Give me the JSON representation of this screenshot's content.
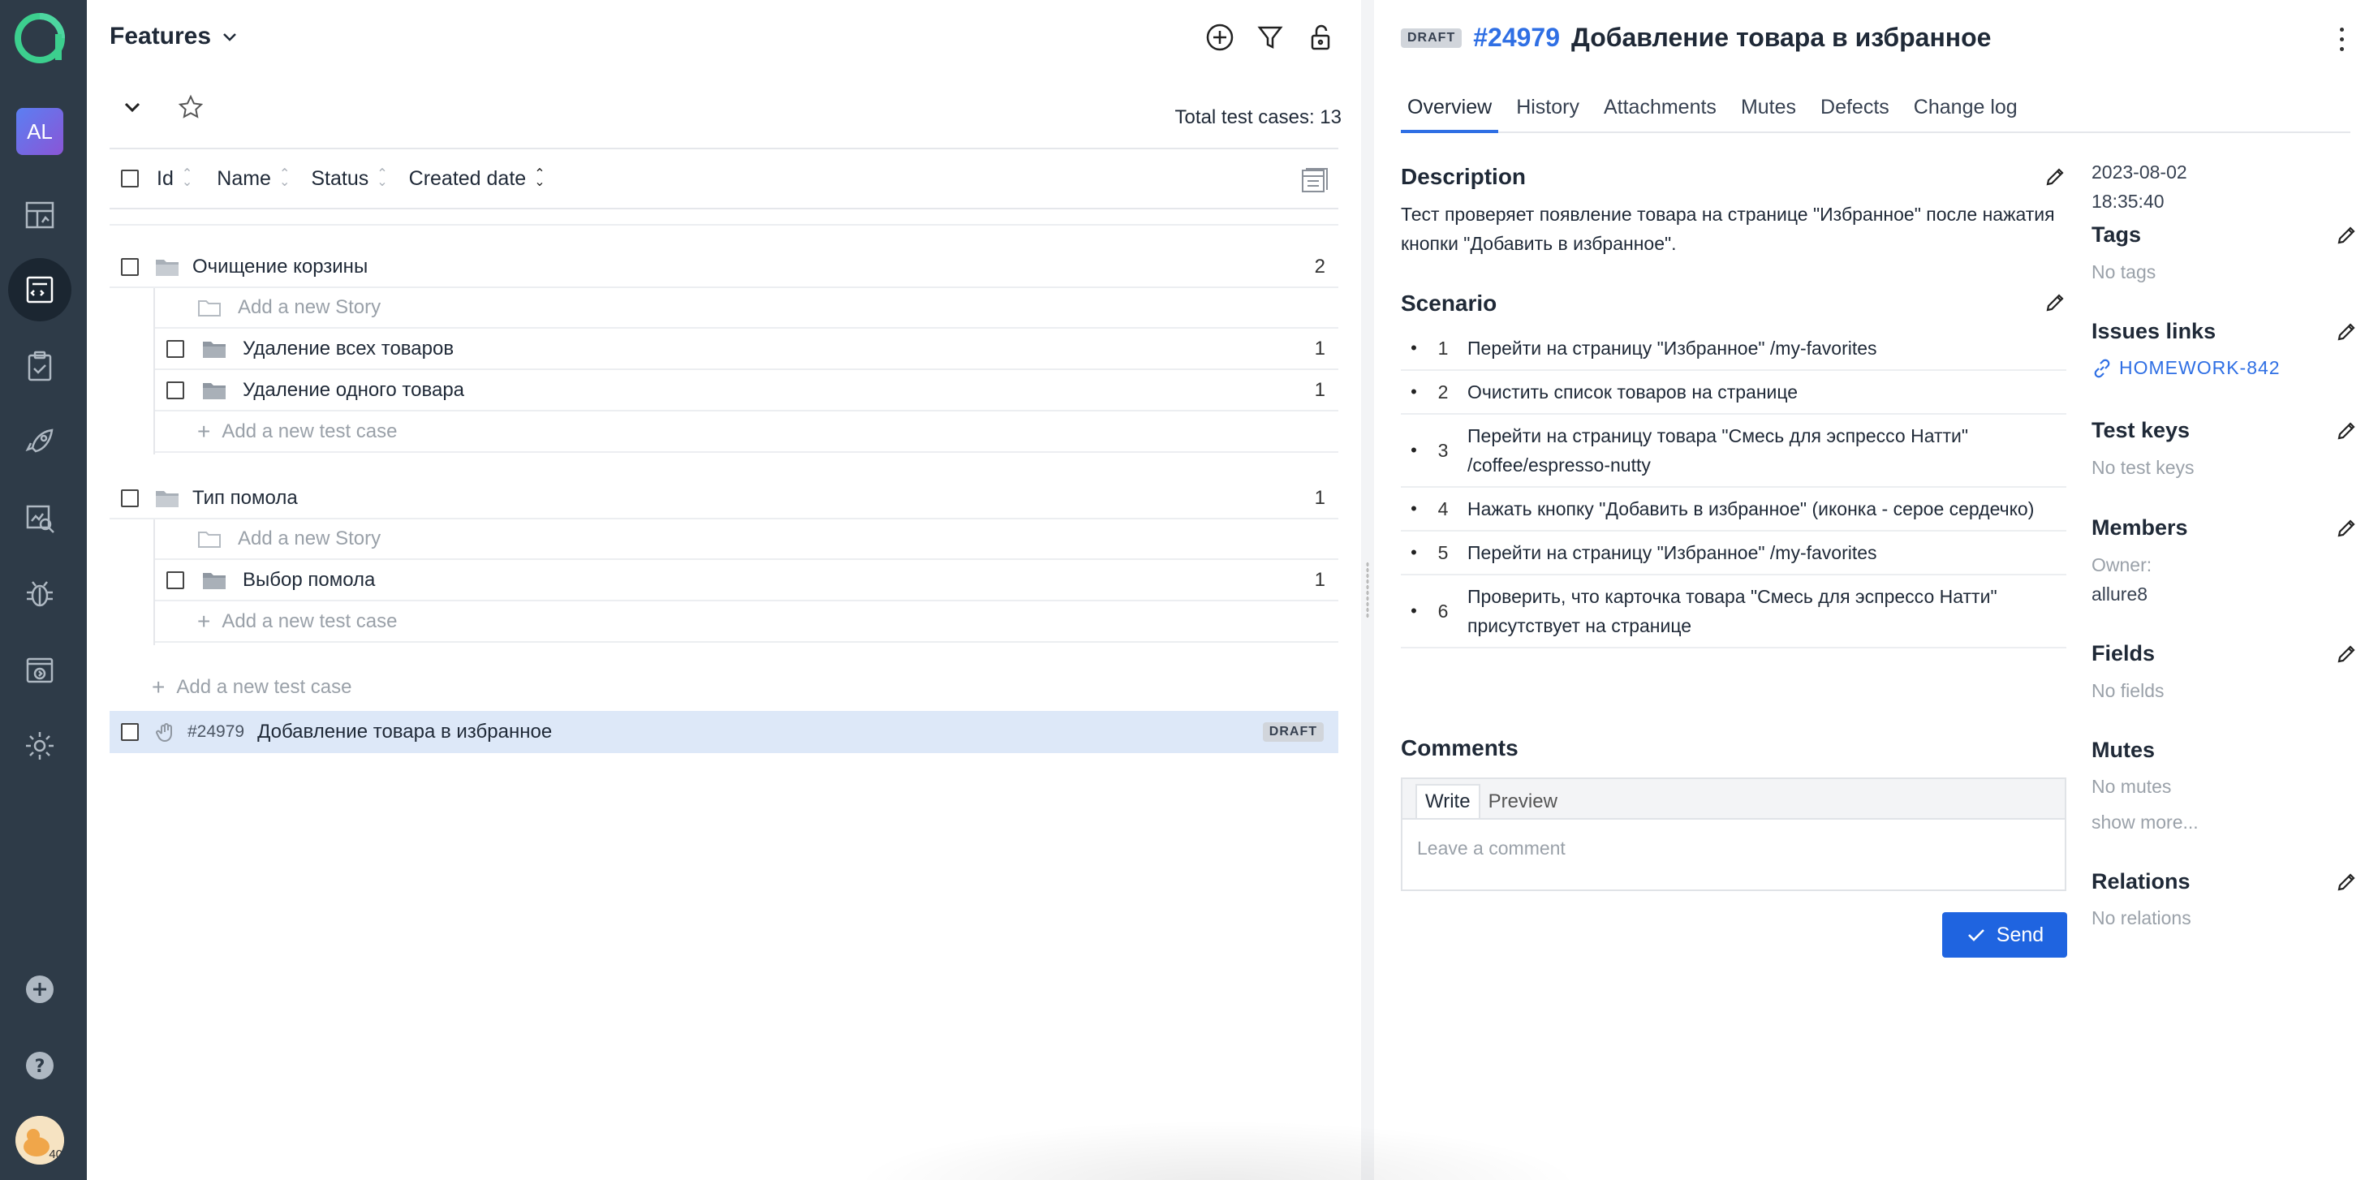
{
  "rail": {
    "avatar_initials": "AL",
    "user_badge": "40",
    "icons": [
      "dashboard-icon",
      "test-cases-icon",
      "test-plans-icon",
      "launches-icon",
      "analytics-icon",
      "defects-icon",
      "jobs-icon",
      "settings-icon",
      "add-project-icon",
      "help-icon"
    ]
  },
  "left": {
    "title": "Features",
    "total_label": "Total test cases: 13",
    "columns": [
      "Id",
      "Name",
      "Status",
      "Created date"
    ],
    "groups": [
      {
        "name": "Очищение корзины",
        "count": "2",
        "add_story": "Add a new Story",
        "children": [
          {
            "name": "Удаление всех товаров",
            "count": "1"
          },
          {
            "name": "Удаление одного товара",
            "count": "1"
          }
        ],
        "add_test_case": "Add a new test case"
      },
      {
        "name": "Тип помола",
        "count": "1",
        "add_story": "Add a new Story",
        "children": [
          {
            "name": "Выбор помола",
            "count": "1"
          }
        ],
        "add_test_case": "Add a new test case"
      }
    ],
    "add_test_case": "Add a new test case",
    "selected": {
      "id": "#24979",
      "name": "Добавление товара в избранное",
      "badge": "DRAFT"
    }
  },
  "right": {
    "badge": "DRAFT",
    "number": "#24979",
    "title": "Добавление товара в избранное",
    "tabs": [
      "Overview",
      "History",
      "Attachments",
      "Mutes",
      "Defects",
      "Change log"
    ],
    "description_title": "Description",
    "description": "Тест проверяет появление товара на странице \"Избранное\" после нажатия кнопки \"Добавить в избранное\".",
    "scenario_title": "Scenario",
    "steps": [
      {
        "n": "1",
        "text": "Перейти на страницу \"Избранное\"  /my-favorites"
      },
      {
        "n": "2",
        "text": "Очистить список товаров на странице"
      },
      {
        "n": "3",
        "text": "Перейти на страницу товара \"Смесь для эспрессо Натти\" /coffee/espresso-nutty"
      },
      {
        "n": "4",
        "text": "Нажать кнопку \"Добавить в избранное\" (иконка - серое сердечко)"
      },
      {
        "n": "5",
        "text": "Перейти на страницу \"Избранное\" /my-favorites"
      },
      {
        "n": "6",
        "text": "Проверить, что карточка товара \"Смесь для эспрессо Натти\" присутствует на странице"
      }
    ],
    "comments_title": "Comments",
    "comment_tabs": [
      "Write",
      "Preview"
    ],
    "comment_placeholder": "Leave a comment",
    "send_label": "Send",
    "side": {
      "date": "2023-08-02",
      "time": "18:35:40",
      "tags_title": "Tags",
      "tags_value": "No tags",
      "issues_title": "Issues links",
      "issue_link": "HOMEWORK-842",
      "testkeys_title": "Test keys",
      "testkeys_value": "No test keys",
      "members_title": "Members",
      "owner_label": "Owner:",
      "owner_value": "allure8",
      "fields_title": "Fields",
      "fields_value": "No fields",
      "mutes_title": "Mutes",
      "mutes_value": "No mutes",
      "show_more": "show more...",
      "relations_title": "Relations",
      "relations_value": "No relations"
    }
  },
  "colors": {
    "accent": "#2f6fe4",
    "rail": "#2e3b48",
    "selected_row": "#dde8f8",
    "send": "#1f64e0"
  }
}
